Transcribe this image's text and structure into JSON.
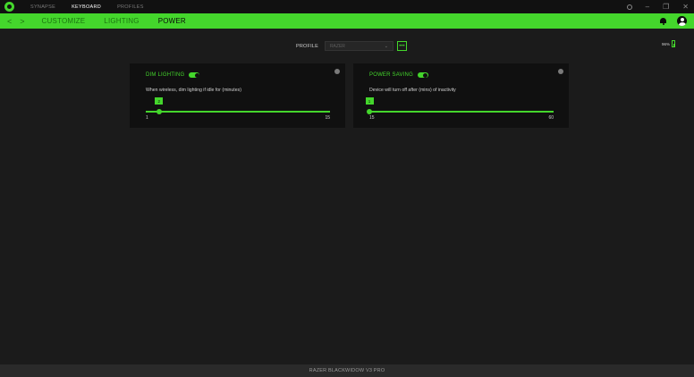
{
  "titlebar": {
    "nav": [
      "SYNAPSE",
      "KEYBOARD",
      "PROFILES"
    ],
    "active_nav": "KEYBOARD",
    "controls": {
      "minimize": "–",
      "maximize": "❐",
      "close": "✕"
    }
  },
  "tabbar": {
    "back": "<",
    "forward": ">",
    "tabs": [
      "CUSTOMIZE",
      "LIGHTING",
      "POWER"
    ],
    "active_tab": "POWER"
  },
  "profile": {
    "label": "PROFILE",
    "selected": "RAZER",
    "more_label": "•••"
  },
  "battery": {
    "percent": "96%"
  },
  "dim_lighting": {
    "title": "DIM LIGHTING",
    "enabled": true,
    "description": "When wireless, dim lighting if idle for (minutes)",
    "value": 2,
    "min_label": "1",
    "max_label": "15"
  },
  "power_saving": {
    "title": "POWER SAVING",
    "enabled": true,
    "description": "Device will turn off after (mins) of inactivity",
    "value": 1,
    "min_label": "15",
    "max_label": "60"
  },
  "statusbar": {
    "device": "RAZER BLACKWIDOW V3 PRO"
  },
  "colors": {
    "accent": "#44d62c",
    "background": "#1b1b1b",
    "card": "#101010"
  }
}
